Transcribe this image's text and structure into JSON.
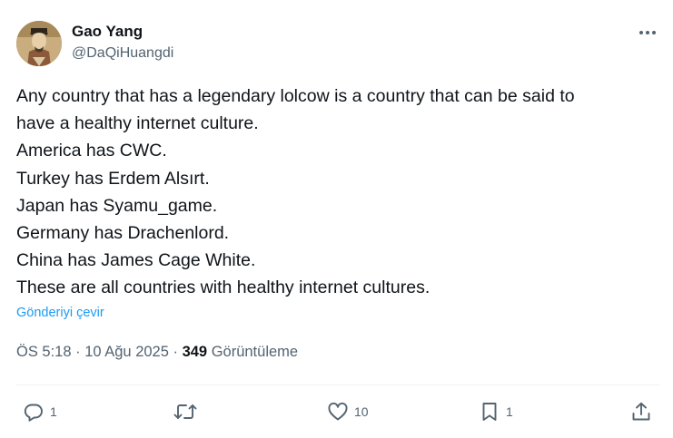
{
  "author": {
    "display_name": "Gao Yang",
    "handle": "@DaQiHuangdi",
    "avatar_icon": "portrait-avatar"
  },
  "tweet": {
    "lines": [
      "Any country that has a legendary lolcow is a country that can be said to",
      "have a healthy internet culture.",
      "America has CWC.",
      "Turkey has Erdem Alsırt.",
      "Japan has Syamu_game.",
      "Germany has Drachenlord.",
      "China has James Cage White.",
      "These are all countries with healthy internet cultures."
    ],
    "translate_label": "Gönderiyi çevir"
  },
  "meta": {
    "time": "ÖS 5:18",
    "sep1": " · ",
    "date": "10 Ağu 2025",
    "sep2": " · ",
    "views_count": "349",
    "views_label": " Görüntüleme"
  },
  "actions": {
    "reply": {
      "icon": "reply-icon",
      "count": "1"
    },
    "retweet": {
      "icon": "retweet-icon",
      "count": ""
    },
    "like": {
      "icon": "heart-icon",
      "count": "10"
    },
    "bookmark": {
      "icon": "bookmark-icon",
      "count": "1"
    },
    "share": {
      "icon": "share-icon",
      "count": ""
    }
  },
  "colors": {
    "text": "#0f1419",
    "secondary": "#536471",
    "link": "#1d9bf0",
    "divider": "#eff3f4"
  }
}
